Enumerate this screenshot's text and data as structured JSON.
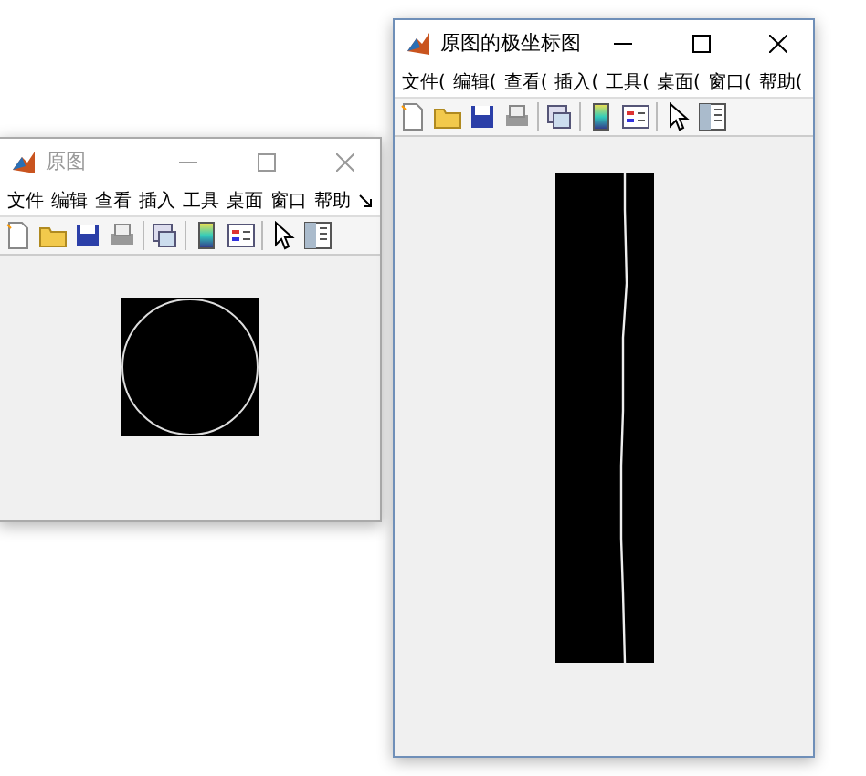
{
  "windows": [
    {
      "title": "原图",
      "active": false,
      "kind": "circle",
      "menu": [
        "文件",
        "编辑",
        "查看",
        "插入",
        "工具",
        "桌面",
        "窗口",
        "帮助"
      ],
      "menu_overflow": true
    },
    {
      "title": "原图的极坐标图",
      "active": true,
      "kind": "polar_strip",
      "menu": [
        "文件(",
        "编辑(",
        "查看(",
        "插入(",
        "工具(",
        "桌面(",
        "窗口(",
        "帮助("
      ],
      "menu_overflow": false
    }
  ]
}
